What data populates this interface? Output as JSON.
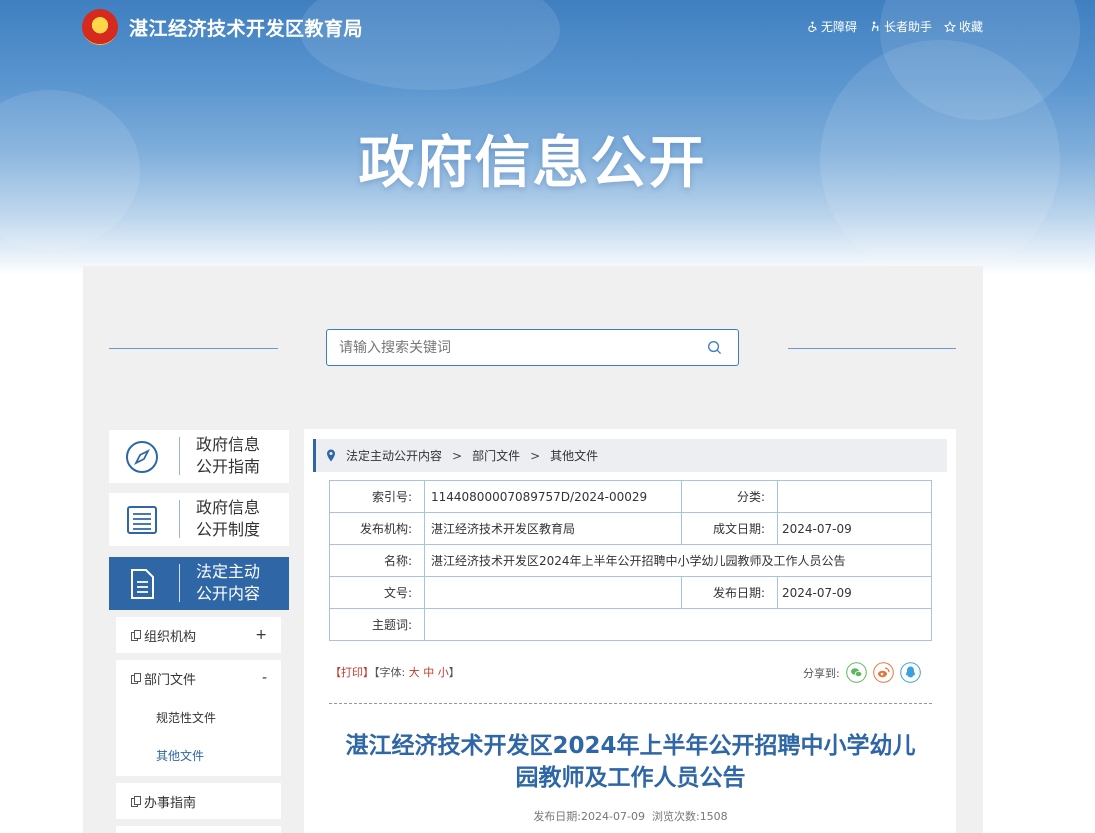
{
  "header": {
    "site_title": "湛江经济技术开发区教育局",
    "links": [
      "无障碍",
      "长者助手",
      "收藏"
    ],
    "banner_title": "政府信息公开"
  },
  "search": {
    "placeholder": "请输入搜索关键词"
  },
  "sidebar": {
    "buttons": [
      {
        "line1": "政府信息",
        "line2": "公开指南",
        "icon": "compass-icon"
      },
      {
        "line1": "政府信息",
        "line2": "公开制度",
        "icon": "list-icon"
      },
      {
        "line1": "法定主动",
        "line2": "公开内容",
        "icon": "document-icon",
        "active": true
      }
    ],
    "tree": [
      {
        "label": "组织机构",
        "toggle": "+"
      },
      {
        "label": "部门文件",
        "toggle": "-",
        "children": [
          "规范性文件",
          "其他文件"
        ]
      },
      {
        "label": "办事指南"
      }
    ]
  },
  "breadcrumb": [
    "法定主动公开内容",
    "部门文件",
    "其他文件"
  ],
  "meta": {
    "index_label": "索引号:",
    "index_value": "11440800007089757D/2024-00029",
    "category_label": "分类:",
    "category_value": "",
    "publisher_label": "发布机构:",
    "publisher_value": "湛江经济技术开发区教育局",
    "created_label": "成文日期:",
    "created_value": "2024-07-09",
    "name_label": "名称:",
    "name_value": "湛江经济技术开发区2024年上半年公开招聘中小学幼儿园教师及工作人员公告",
    "docno_label": "文号:",
    "docno_value": "",
    "pubdate_label": "发布日期:",
    "pubdate_value": "2024-07-09",
    "keywords_label": "主题词:",
    "keywords_value": ""
  },
  "tools": {
    "print": "【打印】",
    "font_label": "【字体:",
    "big": "大",
    "mid": "中",
    "small": "小",
    "close": "】",
    "share_label": "分享到:"
  },
  "article": {
    "title_line1": "湛江经济技术开发区2024年上半年公开招聘中小学幼儿",
    "title_line2": "园教师及工作人员公告",
    "date_label": "发布日期:",
    "date": "2024-07-09",
    "views_label": "浏览次数:",
    "views": "1508"
  },
  "colors": {
    "accent": "#2f67a6",
    "wechat": "#5cb85c",
    "weibo": "#e8743b",
    "qq": "#3aa0de"
  }
}
